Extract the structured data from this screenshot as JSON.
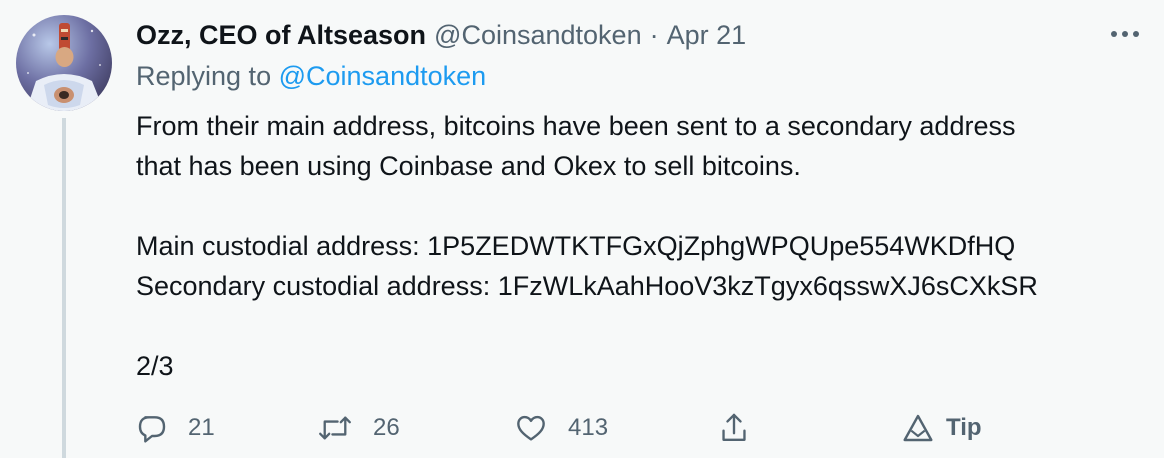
{
  "tweet": {
    "author_name": "Ozz, CEO of Altseason",
    "handle": "@Coinsandtoken",
    "separator": "·",
    "date": "Apr 21",
    "replying_prefix": "Replying to",
    "replying_to": "@Coinsandtoken",
    "text_line_1": "From their main address, bitcoins have been sent to a secondary address",
    "text_line_2": "that has been using Coinbase and Okex to sell bitcoins.",
    "text_line_3": "Main custodial address: 1P5ZEDWTKTFGxQjZphgWPQUpe554WKDfHQ",
    "text_line_4": "Secondary custodial address: 1FzWLkAahHooV3kzTgyx6qsswXJ6sCXkSR",
    "text_line_5": "2/3"
  },
  "actions": {
    "reply_count": "21",
    "retweet_count": "26",
    "like_count": "413",
    "tip_label": "Tip"
  },
  "icons": {
    "more": "more-icon",
    "reply": "reply-icon",
    "retweet": "retweet-icon",
    "like": "heart-icon",
    "share": "share-icon",
    "tip": "tip-icon"
  },
  "colors": {
    "background": "#f7f9f9",
    "text_primary": "#0f1419",
    "text_secondary": "#536471",
    "link": "#1d9bf0",
    "thread_line": "#cfd9de"
  }
}
